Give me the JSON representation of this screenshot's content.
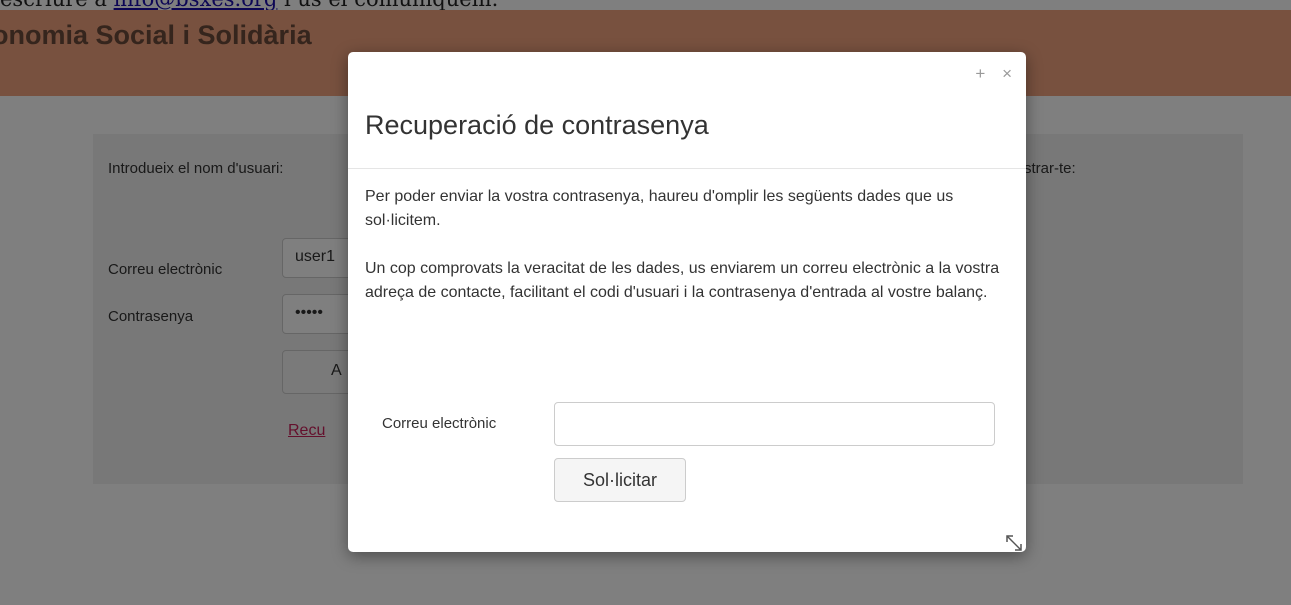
{
  "top_strip": {
    "text_before": "escriure a ",
    "link_text": "info@bsxes.org",
    "text_after": " i us el comuniquem."
  },
  "page": {
    "site_title": "onomia Social i Solidària",
    "intro_left": "Introdueix el nom d'usuari:",
    "intro_right": "strar-te:",
    "email_label": "Correu electrònic",
    "email_value": "user1",
    "password_label": "Contrasenya",
    "password_value": "•••••",
    "access_button": "A",
    "recover_link": "Recu"
  },
  "modal": {
    "plus_icon": "+",
    "close_icon": "×",
    "title": "Recuperació de contrasenya",
    "paragraph1": "Per poder enviar la vostra contrasenya, haureu d'omplir les següents dades que us sol·licitem.",
    "paragraph2": "Un cop comprovats la veracitat de les dades, us enviarem un correu electrònic a la vostra adreça de contacte, facilitant el codi d'usuari i la contrasenya d'entrada al vostre balanç.",
    "email_label": "Correu electrònic",
    "email_value": "",
    "submit_label": "Sol·licitar"
  },
  "colors": {
    "header_band": "#f0a27e",
    "overlay": "rgba(0,0,0,0.5)",
    "link": "#c9215b"
  }
}
